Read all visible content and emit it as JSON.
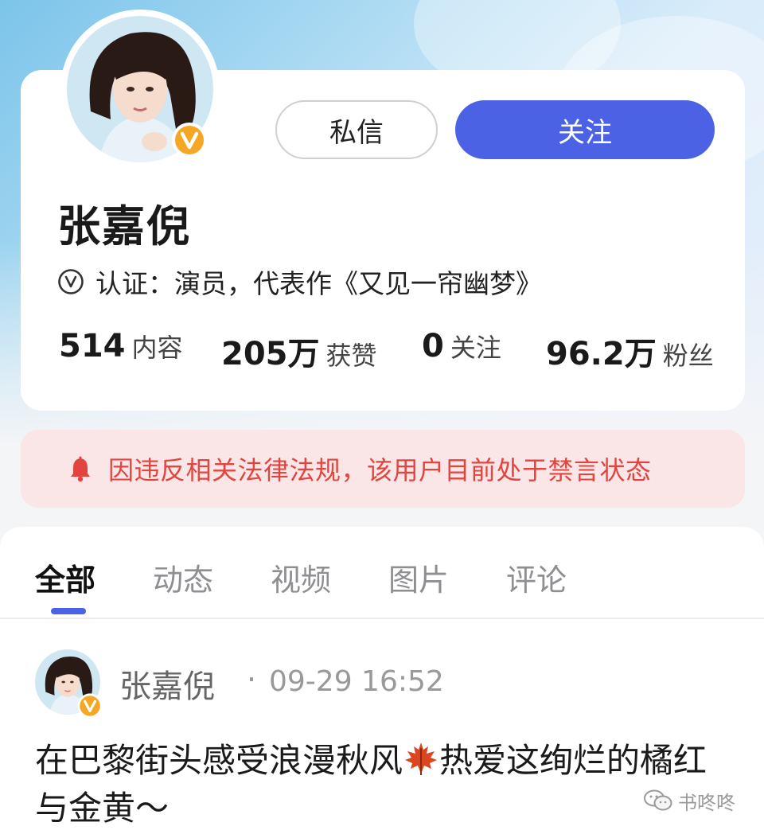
{
  "profile": {
    "name": "张嘉倪",
    "verification": "认证：演员，代表作《又见一帘幽梦》",
    "buttons": {
      "message": "私信",
      "follow": "关注"
    },
    "stats": [
      {
        "value": "514",
        "label": "内容"
      },
      {
        "value": "205万",
        "label": "获赞"
      },
      {
        "value": "0",
        "label": "关注"
      },
      {
        "value": "96.2万",
        "label": "粉丝"
      }
    ]
  },
  "banner": {
    "icon": "bell-icon",
    "text": "因违反相关法律法规，该用户目前处于禁言状态"
  },
  "tabs": [
    {
      "label": "全部",
      "active": true
    },
    {
      "label": "动态",
      "active": false
    },
    {
      "label": "视频",
      "active": false
    },
    {
      "label": "图片",
      "active": false
    },
    {
      "label": "评论",
      "active": false
    }
  ],
  "post": {
    "author": "张嘉倪",
    "separator": "·",
    "time": "09-29 16:52",
    "text_before_emoji": "在巴黎街头感受浪漫秋风",
    "emoji": "maple-leaf-icon",
    "text_after_emoji": "热爱这绚烂的橘红与金黄～"
  },
  "watermark": {
    "icon": "wechat-icon",
    "text": "书咚咚"
  },
  "colors": {
    "accent": "#4a62e3",
    "warning_text": "#e2443f",
    "warning_bg": "#fae6e6",
    "verified_badge": "#f5a623"
  }
}
